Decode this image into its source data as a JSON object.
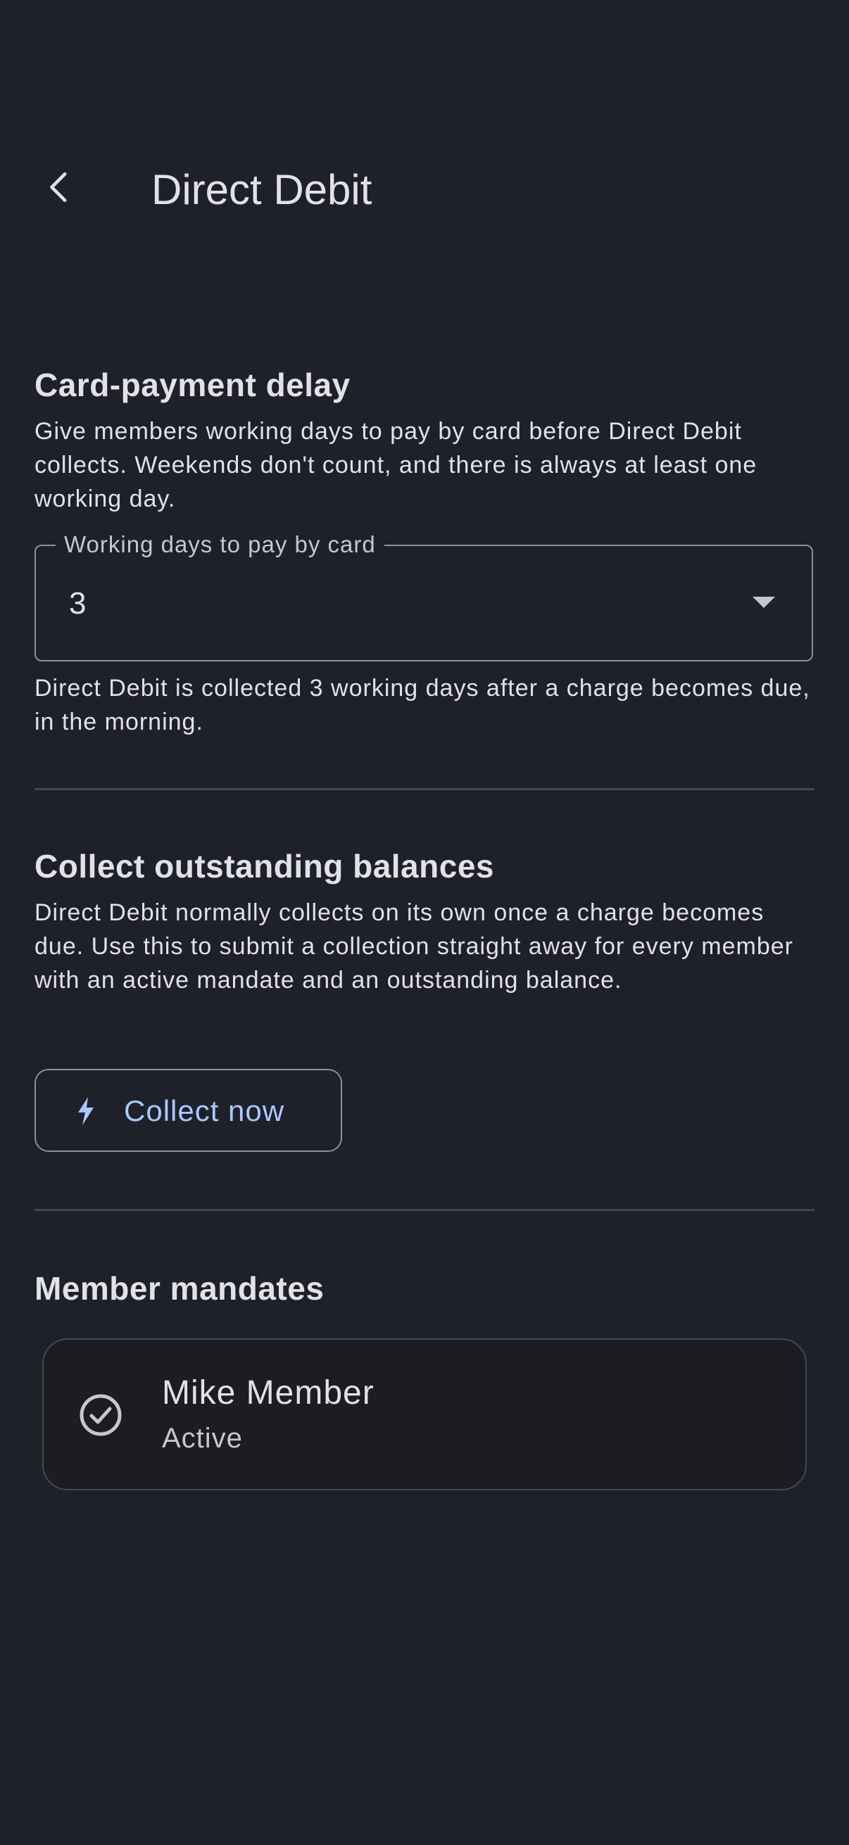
{
  "app_bar": {
    "title": "Direct Debit",
    "back_icon": "arrow-back-icon"
  },
  "card_payment_delay": {
    "heading": "Card-payment delay",
    "description": "Give members working days to pay by card before Direct Debit collects. Weekends don't count, and there is always at least one working day.",
    "select": {
      "label": "Working days to pay by card",
      "value": "3",
      "icon": "dropdown-arrow-icon"
    },
    "helper_text": "Direct Debit is collected 3 working days after a charge becomes due, in the morning."
  },
  "collect_outstanding": {
    "heading": "Collect outstanding balances",
    "description": "Direct Debit normally collects on its own once a charge becomes due. Use this to submit a collection straight away for every member with an active mandate and an outstanding balance.",
    "button": {
      "label": "Collect now",
      "icon": "bolt-icon"
    }
  },
  "member_mandates": {
    "heading": "Member mandates",
    "items": [
      {
        "name": "Mike Member",
        "status": "Active",
        "icon": "check-circle-icon"
      }
    ]
  },
  "colors": {
    "background": "#1e212a",
    "accent": "#aac7ff",
    "outline": "#8e9099",
    "divider": "#44474f",
    "card": "#1b1d20"
  }
}
